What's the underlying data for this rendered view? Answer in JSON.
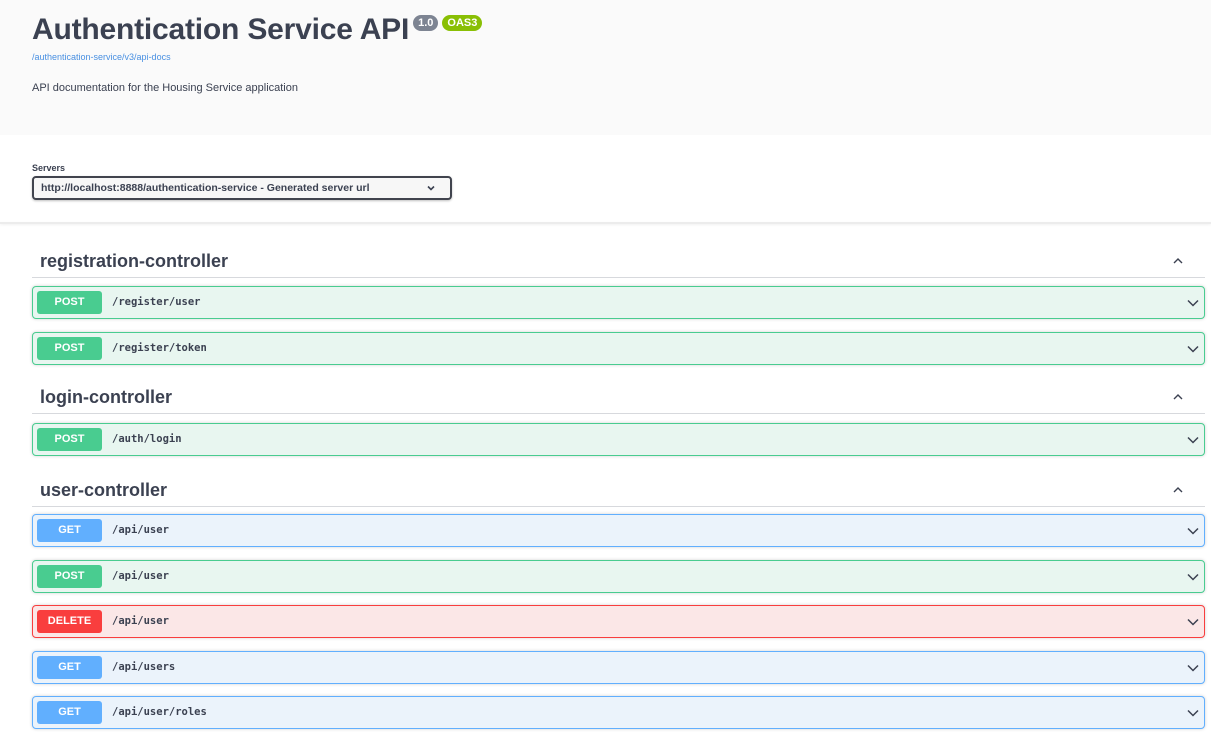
{
  "info": {
    "title": "Authentication Service API",
    "version": "1.0",
    "oas": "OAS3",
    "docs_link": "/authentication-service/v3/api-docs",
    "description": "API documentation for the Housing Service application"
  },
  "servers": {
    "label": "Servers",
    "selected": "http://localhost:8888/authentication-service - Generated server url"
  },
  "tags": [
    {
      "name": "registration-controller",
      "operations": [
        {
          "method": "POST",
          "path": "/register/user"
        },
        {
          "method": "POST",
          "path": "/register/token"
        }
      ]
    },
    {
      "name": "login-controller",
      "operations": [
        {
          "method": "POST",
          "path": "/auth/login"
        }
      ]
    },
    {
      "name": "user-controller",
      "operations": [
        {
          "method": "GET",
          "path": "/api/user"
        },
        {
          "method": "POST",
          "path": "/api/user"
        },
        {
          "method": "DELETE",
          "path": "/api/user"
        },
        {
          "method": "GET",
          "path": "/api/users"
        },
        {
          "method": "GET",
          "path": "/api/user/roles"
        }
      ]
    }
  ],
  "colors": {
    "post": "#49cc90",
    "get": "#61affe",
    "delete": "#f93e3e",
    "link": "#4990e2",
    "oas_badge": "#89bf04",
    "version_badge": "#7d8492"
  }
}
